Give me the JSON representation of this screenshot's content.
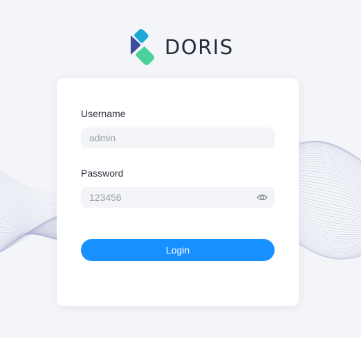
{
  "brand": {
    "name": "DORIS",
    "colors": {
      "mark_blue": "#1fa7d6",
      "mark_navy": "#3b4d9c",
      "mark_green": "#4ccf9a",
      "text": "#262a3a"
    }
  },
  "form": {
    "username": {
      "label": "Username",
      "value": "",
      "placeholder": "admin"
    },
    "password": {
      "label": "Password",
      "value": "",
      "placeholder": "123456",
      "toggle_icon": "eye-icon"
    },
    "login_label": "Login"
  },
  "theme": {
    "accent": "#1890ff",
    "background": "#f4f5f9",
    "card": "#ffffff",
    "input_bg": "#f3f4f7"
  }
}
